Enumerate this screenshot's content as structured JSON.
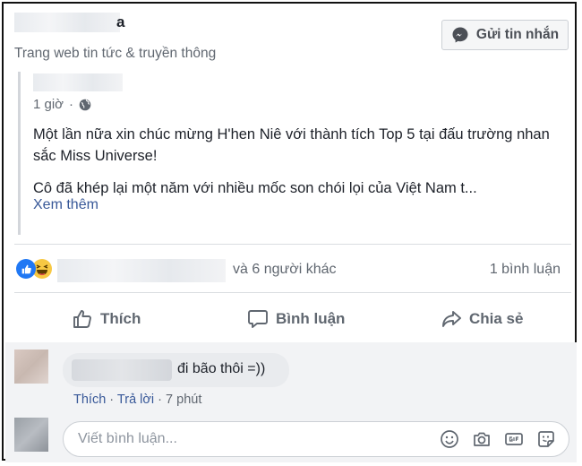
{
  "page": {
    "name_visible": "a",
    "category": "Trang web tin tức & truyền thông",
    "message_button": "Gửi tin nhắn"
  },
  "shared_post": {
    "time": "1 giờ",
    "paragraph_1": "Một lần nữa xin chúc mừng H'hen Niê với thành tích Top 5 tại đấu trường nhan sắc Miss Universe!",
    "paragraph_2": "Cô đã khép lại một năm với nhiều mốc son chói lọi của Việt Nam t...",
    "see_more": "Xem thêm"
  },
  "reactions": {
    "others": "và 6 người khác",
    "comment_count": "1 bình luận",
    "types": [
      "like",
      "haha"
    ]
  },
  "actions": {
    "like": "Thích",
    "comment": "Bình luận",
    "share": "Chia sẻ"
  },
  "comment": {
    "text": "đi bão thôi =))",
    "like": "Thích",
    "reply": "Trả lời",
    "time": "7 phút",
    "separator": "·"
  },
  "composer": {
    "placeholder": "Viết bình luận...",
    "tools": [
      "emoji-icon",
      "camera-icon",
      "gif-icon",
      "sticker-icon"
    ]
  },
  "colors": {
    "link": "#385898",
    "secondary_text": "#606770",
    "like_blue": "#2078f4",
    "haha_yellow": "#f7c843"
  }
}
